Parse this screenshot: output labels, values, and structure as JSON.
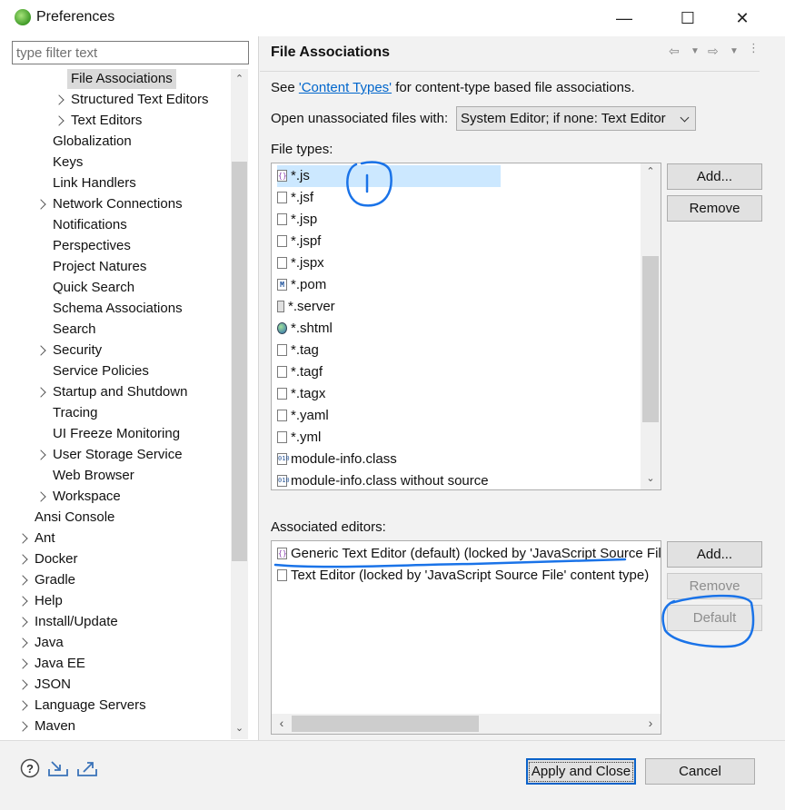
{
  "window": {
    "title": "Preferences",
    "minimize_glyph": "—",
    "maximize_glyph": "☐",
    "close_glyph": "✕"
  },
  "filter": {
    "placeholder": "type filter text"
  },
  "tree": [
    {
      "label": "File Associations",
      "expandable": false,
      "selected": true,
      "level": 3
    },
    {
      "label": "Structured Text Editors",
      "expandable": true,
      "level": 3
    },
    {
      "label": "Text Editors",
      "expandable": true,
      "level": 3
    },
    {
      "label": "Globalization",
      "expandable": false,
      "level": 2
    },
    {
      "label": "Keys",
      "expandable": false,
      "level": 2
    },
    {
      "label": "Link Handlers",
      "expandable": false,
      "level": 2
    },
    {
      "label": "Network Connections",
      "expandable": true,
      "level": 2
    },
    {
      "label": "Notifications",
      "expandable": false,
      "level": 2
    },
    {
      "label": "Perspectives",
      "expandable": false,
      "level": 2
    },
    {
      "label": "Project Natures",
      "expandable": false,
      "level": 2
    },
    {
      "label": "Quick Search",
      "expandable": false,
      "level": 2
    },
    {
      "label": "Schema Associations",
      "expandable": false,
      "level": 2
    },
    {
      "label": "Search",
      "expandable": false,
      "level": 2
    },
    {
      "label": "Security",
      "expandable": true,
      "level": 2
    },
    {
      "label": "Service Policies",
      "expandable": false,
      "level": 2
    },
    {
      "label": "Startup and Shutdown",
      "expandable": true,
      "level": 2
    },
    {
      "label": "Tracing",
      "expandable": false,
      "level": 2
    },
    {
      "label": "UI Freeze Monitoring",
      "expandable": false,
      "level": 2
    },
    {
      "label": "User Storage Service",
      "expandable": true,
      "level": 2
    },
    {
      "label": "Web Browser",
      "expandable": false,
      "level": 2
    },
    {
      "label": "Workspace",
      "expandable": true,
      "level": 2
    },
    {
      "label": "Ansi Console",
      "expandable": false,
      "level": 1
    },
    {
      "label": "Ant",
      "expandable": true,
      "level": 1
    },
    {
      "label": "Docker",
      "expandable": true,
      "level": 1
    },
    {
      "label": "Gradle",
      "expandable": true,
      "level": 1
    },
    {
      "label": "Help",
      "expandable": true,
      "level": 1
    },
    {
      "label": "Install/Update",
      "expandable": true,
      "level": 1
    },
    {
      "label": "Java",
      "expandable": true,
      "level": 1
    },
    {
      "label": "Java EE",
      "expandable": true,
      "level": 1
    },
    {
      "label": "JSON",
      "expandable": true,
      "level": 1
    },
    {
      "label": "Language Servers",
      "expandable": true,
      "level": 1
    },
    {
      "label": "Maven",
      "expandable": true,
      "level": 1
    }
  ],
  "page": {
    "title": "File Associations",
    "see_prefix": "See ",
    "see_link": "'Content Types'",
    "see_suffix": " for content-type based file associations.",
    "open_unassociated_label": "Open unassociated files with:",
    "open_unassociated_value": "System Editor; if none: Text Editor",
    "file_types_label": "File types:",
    "associated_editors_label": "Associated editors:"
  },
  "file_types": [
    {
      "label": "*.js",
      "icon": "js-file-icon",
      "selected": true
    },
    {
      "label": "*.jsf",
      "icon": "text-file-icon"
    },
    {
      "label": "*.jsp",
      "icon": "text-file-icon"
    },
    {
      "label": "*.jspf",
      "icon": "text-file-icon"
    },
    {
      "label": "*.jspx",
      "icon": "text-file-icon"
    },
    {
      "label": "*.pom",
      "icon": "maven-file-icon"
    },
    {
      "label": "*.server",
      "icon": "server-file-icon"
    },
    {
      "label": "*.shtml",
      "icon": "web-globe-icon"
    },
    {
      "label": "*.tag",
      "icon": "text-file-icon"
    },
    {
      "label": "*.tagf",
      "icon": "text-file-icon"
    },
    {
      "label": "*.tagx",
      "icon": "text-file-icon"
    },
    {
      "label": "*.yaml",
      "icon": "text-file-icon"
    },
    {
      "label": "*.yml",
      "icon": "text-file-icon"
    },
    {
      "label": "module-info.class",
      "icon": "class-file-icon"
    },
    {
      "label": "module-info.class without source",
      "icon": "class-file-icon"
    }
  ],
  "editors": [
    {
      "label": "Generic Text Editor (default) (locked by 'JavaScript Source File' content type)",
      "icon": "js-file-icon"
    },
    {
      "label": "Text Editor (locked by 'JavaScript Source File' content type)",
      "icon": "text-file-icon"
    }
  ],
  "buttons": {
    "ft_add": "Add...",
    "ft_remove": "Remove",
    "ed_add": "Add...",
    "ed_remove": "Remove",
    "ed_default": "Default",
    "apply_close": "Apply and Close",
    "cancel": "Cancel"
  },
  "icon_glyphs": {
    "help": "?",
    "file_icon_letter": "{}",
    "pom_letter": "M",
    "class_letter": "010"
  },
  "colors": {
    "selection": "#cce8ff",
    "link": "#0066cc",
    "annotation": "#1a73e8"
  }
}
